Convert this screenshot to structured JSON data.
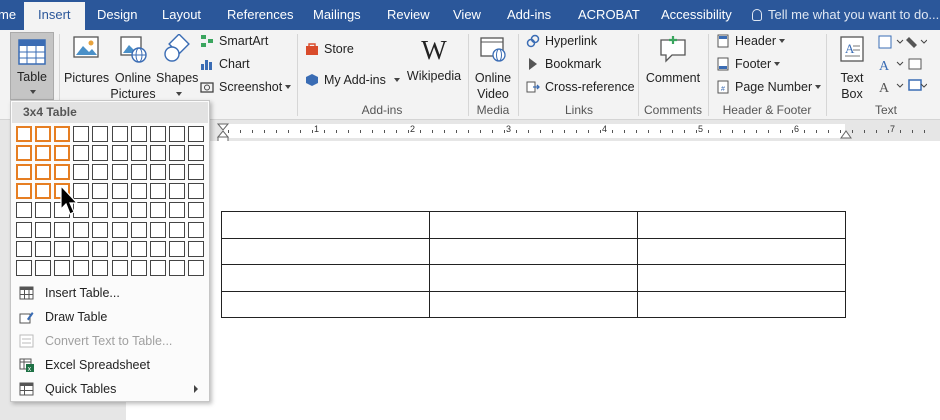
{
  "tabs": [
    {
      "id": "home",
      "label": "me"
    },
    {
      "id": "insert",
      "label": "Insert"
    },
    {
      "id": "design",
      "label": "Design"
    },
    {
      "id": "layout",
      "label": "Layout"
    },
    {
      "id": "references",
      "label": "References"
    },
    {
      "id": "mailings",
      "label": "Mailings"
    },
    {
      "id": "review",
      "label": "Review"
    },
    {
      "id": "view",
      "label": "View"
    },
    {
      "id": "addins",
      "label": "Add-ins"
    },
    {
      "id": "acrobat",
      "label": "ACROBAT"
    },
    {
      "id": "accessibility",
      "label": "Accessibility"
    }
  ],
  "tell_me": {
    "placeholder": "Tell me what you want to do..."
  },
  "ribbon": {
    "table": {
      "label": "Table"
    },
    "illustrations": {
      "pictures": "Pictures",
      "online_pictures_1": "Online",
      "online_pictures_2": "Pictures",
      "shapes": "Shapes",
      "smartart": "SmartArt",
      "chart": "Chart",
      "screenshot": "Screenshot"
    },
    "addins": {
      "store": "Store",
      "my_addins": "My Add-ins",
      "wikipedia": "Wikipedia",
      "group_label": "Add-ins"
    },
    "media": {
      "online_video_1": "Online",
      "online_video_2": "Video",
      "group_label": "Media"
    },
    "links": {
      "hyperlink": "Hyperlink",
      "bookmark": "Bookmark",
      "cross_reference": "Cross-reference",
      "group_label": "Links"
    },
    "comments": {
      "comment": "Comment",
      "group_label": "Comments"
    },
    "header_footer": {
      "header": "Header",
      "footer": "Footer",
      "page_number": "Page Number",
      "group_label": "Header & Footer"
    },
    "text": {
      "text_box_1": "Text",
      "text_box_2": "Box",
      "group_label": "Text"
    }
  },
  "ruler": {
    "numbers": [
      "1",
      "2",
      "3",
      "4",
      "5",
      "6",
      "7"
    ]
  },
  "table_dropdown": {
    "header": "3x4 Table",
    "grid": {
      "columns": 10,
      "rows": 8,
      "selected_columns": 3,
      "selected_rows": 4
    },
    "items": [
      {
        "id": "insert_table",
        "label": "Insert Table...",
        "enabled": true
      },
      {
        "id": "draw_table",
        "label": "Draw Table",
        "enabled": true
      },
      {
        "id": "convert_text",
        "label": "Convert Text to Table...",
        "enabled": false
      },
      {
        "id": "excel",
        "label": "Excel Spreadsheet",
        "enabled": true
      },
      {
        "id": "quick_tables",
        "label": "Quick Tables",
        "enabled": true,
        "submenu": true
      }
    ]
  },
  "document": {
    "table": {
      "rows": 4,
      "columns": 3
    }
  },
  "colors": {
    "ribbon_blue": "#2b579a",
    "grid_selected": "#e67e22"
  }
}
